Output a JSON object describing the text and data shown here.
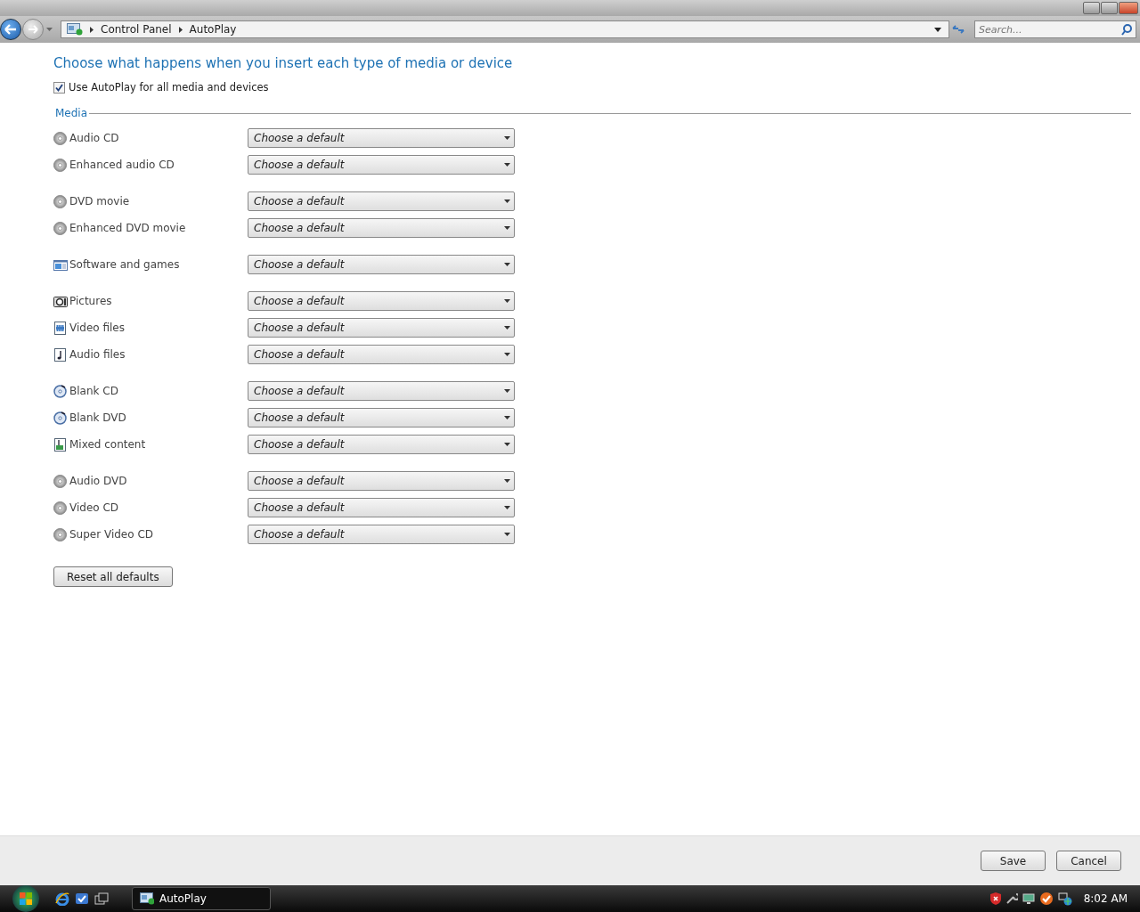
{
  "address_bar": {
    "crumbs": [
      "Control Panel",
      "AutoPlay"
    ]
  },
  "search": {
    "placeholder": "Search..."
  },
  "heading": "Choose what happens when you insert each type of media or device",
  "use_autoplay": {
    "label": "Use AutoPlay for all media and devices",
    "checked": true
  },
  "media": {
    "title": "Media",
    "groups": [
      {
        "items": [
          {
            "kind": "disc",
            "label": "Audio CD",
            "value": "Choose a default"
          },
          {
            "kind": "disc",
            "label": "Enhanced audio CD",
            "value": "Choose a default"
          }
        ]
      },
      {
        "items": [
          {
            "kind": "disc",
            "label": "DVD movie",
            "value": "Choose a default"
          },
          {
            "kind": "disc",
            "label": "Enhanced DVD movie",
            "value": "Choose a default"
          }
        ]
      },
      {
        "items": [
          {
            "kind": "software",
            "label": "Software and games",
            "value": "Choose a default"
          }
        ]
      },
      {
        "items": [
          {
            "kind": "pictures",
            "label": "Pictures",
            "value": "Choose a default"
          },
          {
            "kind": "video",
            "label": "Video files",
            "value": "Choose a default"
          },
          {
            "kind": "audio",
            "label": "Audio files",
            "value": "Choose a default"
          }
        ]
      },
      {
        "items": [
          {
            "kind": "blank",
            "label": "Blank CD",
            "value": "Choose a default"
          },
          {
            "kind": "blank",
            "label": "Blank DVD",
            "value": "Choose a default"
          },
          {
            "kind": "mixed",
            "label": "Mixed content",
            "value": "Choose a default"
          }
        ]
      },
      {
        "items": [
          {
            "kind": "disc",
            "label": "Audio DVD",
            "value": "Choose a default"
          },
          {
            "kind": "disc",
            "label": "Video CD",
            "value": "Choose a default"
          },
          {
            "kind": "disc",
            "label": "Super Video CD",
            "value": "Choose a default"
          }
        ]
      }
    ]
  },
  "reset_button": "Reset all defaults",
  "buttons": [
    "Save",
    "Cancel"
  ],
  "taskbar": {
    "tasks": [
      "AutoPlay"
    ],
    "clock": "8:02 AM"
  }
}
